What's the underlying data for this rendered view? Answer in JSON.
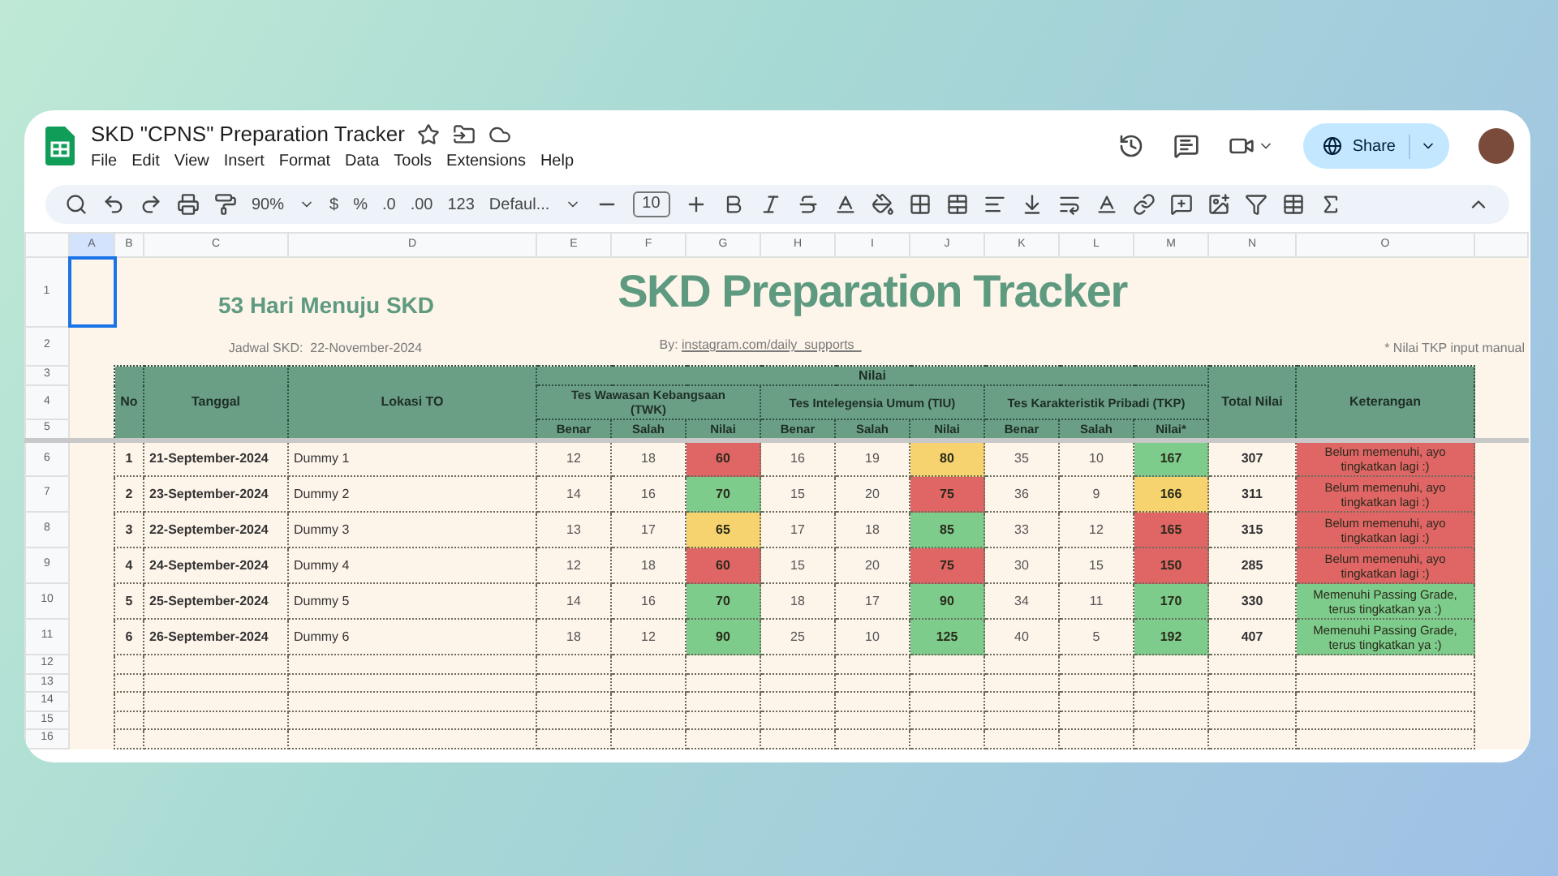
{
  "doc": {
    "title": "SKD \"CPNS\" Preparation Tracker",
    "menu": [
      "File",
      "Edit",
      "View",
      "Insert",
      "Format",
      "Data",
      "Tools",
      "Extensions",
      "Help"
    ],
    "share": "Share"
  },
  "toolbar": {
    "zoom": "90%",
    "currency": "$",
    "percent": "%",
    "decrease_decimals": ".0",
    "increase_decimals": ".00",
    "number_format": "123",
    "font": "Defaul...",
    "font_size": "10"
  },
  "column_letters": [
    "A",
    "B",
    "C",
    "D",
    "E",
    "F",
    "G",
    "H",
    "I",
    "J",
    "K",
    "L",
    "M",
    "N",
    "O"
  ],
  "row_numbers": [
    "1",
    "2",
    "3",
    "4",
    "5",
    "6",
    "7",
    "8",
    "9",
    "10",
    "11",
    "12",
    "13",
    "14",
    "15",
    "16"
  ],
  "sheet": {
    "countdown": "53 Hari Menuju SKD",
    "title": "SKD Preparation Tracker",
    "schedule": "Jadwal SKD:  22-November-2024",
    "credit": "By:",
    "credit_link": "instagram.com/daily_supports_",
    "note": "* Nilai TKP input manual"
  },
  "header": {
    "no": "No",
    "date": "Tanggal",
    "location": "Lokasi TO",
    "scores": "Nilai",
    "total": "Total Nilai",
    "remarks": "Keterangan",
    "groups": [
      {
        "name": "Tes Wawasan Kebangsaan (TWK)",
        "columns": [
          "Benar",
          "Salah",
          "Nilai"
        ]
      },
      {
        "name": "Tes Intelegensia Umum (TIU)",
        "columns": [
          "Benar",
          "Salah",
          "Nilai"
        ]
      },
      {
        "name": "Tes Karakteristik Pribadi (TKP)",
        "columns": [
          "Benar",
          "Salah",
          "Nilai*"
        ]
      }
    ]
  },
  "rows": [
    {
      "no": "1",
      "date": "21-September-2024",
      "location": "Dummy 1",
      "tests": [
        {
          "correct": "12",
          "wrong": "18",
          "score": "60",
          "color": "#e06666"
        },
        {
          "correct": "16",
          "wrong": "19",
          "score": "80",
          "color": "#f6d36f"
        },
        {
          "correct": "35",
          "wrong": "10",
          "score": "167",
          "color": "#7dcc8c"
        }
      ],
      "total": "307",
      "remark": {
        "text": "Belum memenuhi, ayo tingkatkan lagi :)",
        "color": "#e06666"
      }
    },
    {
      "no": "2",
      "date": "23-September-2024",
      "location": "Dummy 2",
      "tests": [
        {
          "correct": "14",
          "wrong": "16",
          "score": "70",
          "color": "#7dcc8c"
        },
        {
          "correct": "15",
          "wrong": "20",
          "score": "75",
          "color": "#e06666"
        },
        {
          "correct": "36",
          "wrong": "9",
          "score": "166",
          "color": "#f6d36f"
        }
      ],
      "total": "311",
      "remark": {
        "text": "Belum memenuhi, ayo tingkatkan lagi :)",
        "color": "#e06666"
      }
    },
    {
      "no": "3",
      "date": "22-September-2024",
      "location": "Dummy 3",
      "tests": [
        {
          "correct": "13",
          "wrong": "17",
          "score": "65",
          "color": "#f6d36f"
        },
        {
          "correct": "17",
          "wrong": "18",
          "score": "85",
          "color": "#7dcc8c"
        },
        {
          "correct": "33",
          "wrong": "12",
          "score": "165",
          "color": "#e06666"
        }
      ],
      "total": "315",
      "remark": {
        "text": "Belum memenuhi, ayo tingkatkan lagi :)",
        "color": "#e06666"
      }
    },
    {
      "no": "4",
      "date": "24-September-2024",
      "location": "Dummy 4",
      "tests": [
        {
          "correct": "12",
          "wrong": "18",
          "score": "60",
          "color": "#e06666"
        },
        {
          "correct": "15",
          "wrong": "20",
          "score": "75",
          "color": "#e06666"
        },
        {
          "correct": "30",
          "wrong": "15",
          "score": "150",
          "color": "#e06666"
        }
      ],
      "total": "285",
      "remark": {
        "text": "Belum memenuhi, ayo tingkatkan lagi :)",
        "color": "#e06666"
      }
    },
    {
      "no": "5",
      "date": "25-September-2024",
      "location": "Dummy 5",
      "tests": [
        {
          "correct": "14",
          "wrong": "16",
          "score": "70",
          "color": "#7dcc8c"
        },
        {
          "correct": "18",
          "wrong": "17",
          "score": "90",
          "color": "#7dcc8c"
        },
        {
          "correct": "34",
          "wrong": "11",
          "score": "170",
          "color": "#7dcc8c"
        }
      ],
      "total": "330",
      "remark": {
        "text": "Memenuhi Passing Grade, terus tingkatkan ya :)",
        "color": "#7dcc8c"
      }
    },
    {
      "no": "6",
      "date": "26-September-2024",
      "location": "Dummy 6",
      "tests": [
        {
          "correct": "18",
          "wrong": "12",
          "score": "90",
          "color": "#7dcc8c"
        },
        {
          "correct": "25",
          "wrong": "10",
          "score": "125",
          "color": "#7dcc8c"
        },
        {
          "correct": "40",
          "wrong": "5",
          "score": "192",
          "color": "#7dcc8c"
        }
      ],
      "total": "407",
      "remark": {
        "text": "Memenuhi Passing Grade, terus tingkatkan ya :)",
        "color": "#7dcc8c"
      }
    }
  ]
}
